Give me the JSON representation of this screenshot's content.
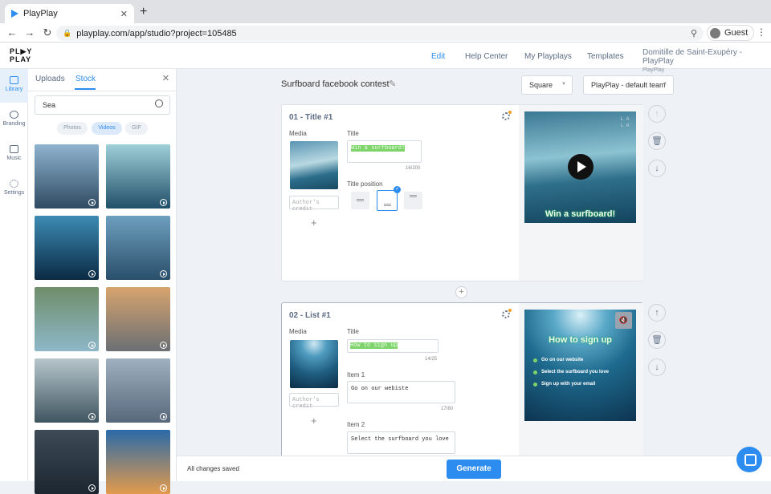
{
  "browser": {
    "tab_title": "PlayPlay",
    "url": "playplay.com/app/studio?project=105485",
    "profile": "Guest"
  },
  "app": {
    "logo_line1": "PL▶Y",
    "logo_line2": "PLAY",
    "nav": [
      "Edit",
      "Help Center",
      "My Playplays",
      "Templates"
    ],
    "active_nav": "Edit",
    "user_name": "Domitille de Saint-Exupéry - PlayPlay",
    "user_org": "PlayPlay"
  },
  "sidebar": {
    "items": [
      {
        "label": "Library",
        "icon": "image-icon",
        "active": true
      },
      {
        "label": "Branding",
        "icon": "palette-icon",
        "active": false
      },
      {
        "label": "Music",
        "icon": "music-icon",
        "active": false
      },
      {
        "label": "Settings",
        "icon": "gear-icon",
        "active": false
      }
    ]
  },
  "library": {
    "tabs": [
      "Uploads",
      "Stock"
    ],
    "active_tab": "Stock",
    "search_value": "Sea",
    "filters": [
      "Photos",
      "Videos",
      "GIF"
    ],
    "active_filter": "Videos",
    "thumb_colors": [
      [
        "#8fb4cf",
        "#2f4a63"
      ],
      [
        "#9fd0d8",
        "#21506a"
      ],
      [
        "#3c8bb3",
        "#0b2a44"
      ],
      [
        "#6e9fbf",
        "#294f6a"
      ],
      [
        "#6f8e6a",
        "#8eb7c9"
      ],
      [
        "#d7a46e",
        "#6b6f74"
      ],
      [
        "#b7c6cc",
        "#3f5560"
      ],
      [
        "#9fb1bf",
        "#56687a"
      ],
      [
        "#3d4b57",
        "#1c2630"
      ],
      [
        "#2a6aa8",
        "#e39a4c"
      ]
    ]
  },
  "project": {
    "title": "Surfboard facebook contest",
    "format": "Square",
    "team": "PlayPlay - default team"
  },
  "cards": [
    {
      "heading": "01 - Title #1",
      "media_label": "Media",
      "credit_placeholder": "Author's credit",
      "title_label": "Title",
      "title_value": "Win a surfboard!",
      "title_count": "16/200",
      "position_label": "Title position",
      "preview_text": "Win a surfboard!",
      "watermark1": "L A",
      "watermark2": "L A'"
    },
    {
      "heading": "02 - List #1",
      "media_label": "Media",
      "credit_placeholder": "Author's credit",
      "title_label": "Title",
      "title_value": "How to sign up",
      "title_count": "14/25",
      "item1_label": "Item 1",
      "item1_value": "Go on our webiste",
      "item1_count": "17/80",
      "item2_label": "Item 2",
      "item2_value": "Select the surfboard you love",
      "preview_title": "How to sign up",
      "preview_items": [
        "Go on our website",
        "Select the surfboard you love",
        "Sign up with your email"
      ]
    }
  ],
  "footer": {
    "status": "All changes saved",
    "generate": "Generate"
  },
  "colors": {
    "accent": "#2d8cf0",
    "highlight": "#7fd36b"
  }
}
